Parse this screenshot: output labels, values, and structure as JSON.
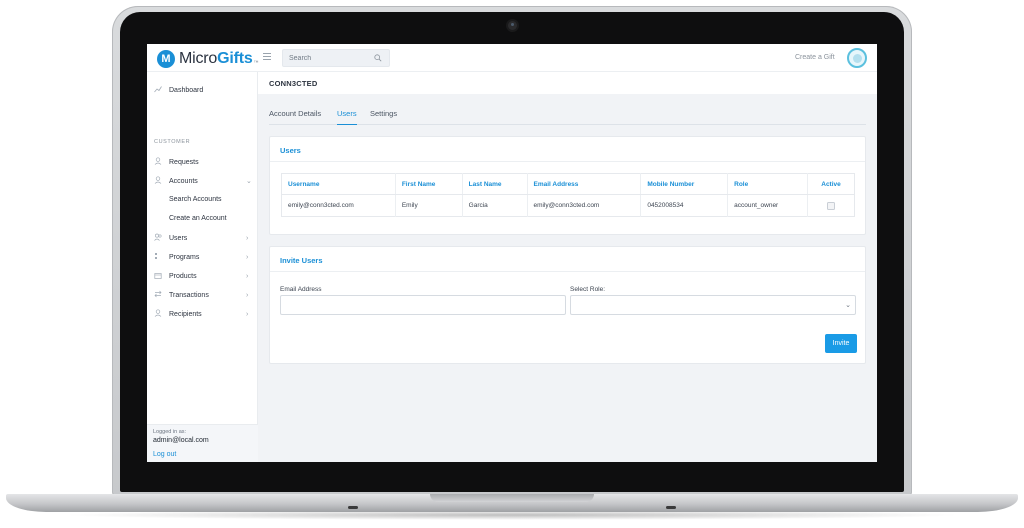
{
  "brand": {
    "name_prefix": "Micro",
    "name_suffix": "Gifts",
    "tm": "™",
    "mark": "M",
    "color": "#1a8fd6"
  },
  "topbar": {
    "search_placeholder": "Search",
    "create_gift": "Create a Gift"
  },
  "sidebar": {
    "dashboard": "Dashboard",
    "section_customer": "CUSTOMER",
    "requests": "Requests",
    "accounts": "Accounts",
    "search_accounts": "Search Accounts",
    "create_account": "Create an Account",
    "users": "Users",
    "programs": "Programs",
    "products": "Products",
    "transactions": "Transactions",
    "recipients": "Recipients",
    "chev_down": "⌄",
    "chev_right": "›"
  },
  "footer": {
    "logged_label": "Logged in as:",
    "user": "admin@local.com",
    "logout": "Log out"
  },
  "page": {
    "title": "CONN3CTED",
    "tabs": [
      "Account Details",
      "Users",
      "Settings"
    ],
    "active_tab": "Users"
  },
  "users_card": {
    "title": "Users",
    "columns": [
      "Username",
      "First Name",
      "Last Name",
      "Email Address",
      "Mobile Number",
      "Role",
      "Active"
    ],
    "rows": [
      {
        "username": "emily@conn3cted.com",
        "first_name": "Emily",
        "last_name": "Garcia",
        "email": "emily@conn3cted.com",
        "mobile": "0452008534",
        "role": "account_owner",
        "active": false
      }
    ]
  },
  "invite_card": {
    "title": "Invite Users",
    "email_label": "Email Address",
    "email_value": "",
    "role_label": "Select Role:",
    "role_value": "",
    "invite_button": "Invite"
  }
}
